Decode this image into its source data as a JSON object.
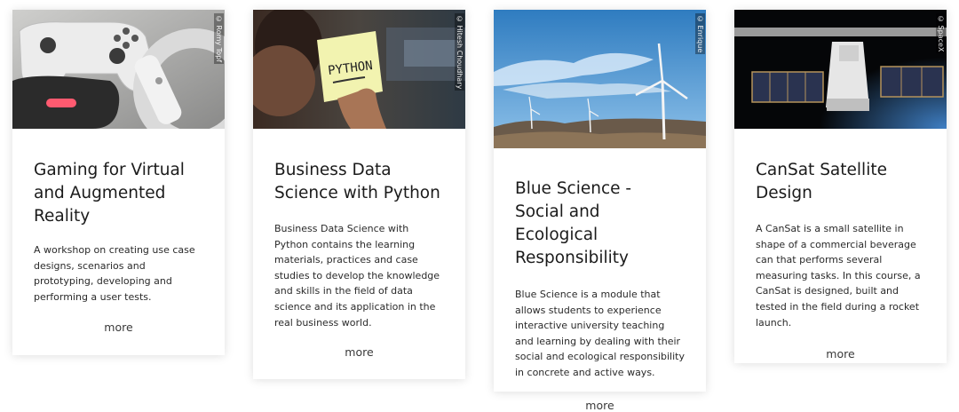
{
  "cards": [
    {
      "title": "Gaming for Virtual and Augmented Reality",
      "description": "A workshop on creating use case designs, scenarios and prototyping, developing and performing a user tests.",
      "more_label": "more",
      "image_credit": "© Romy Topf",
      "image_subject": "game-controllers-image"
    },
    {
      "title": "Business Data Science with Python",
      "description": "Business Data Science with Python contains the learning materials, practices and case studies to develop the knowledge and skills in the field of data science and its application in the real business world.",
      "more_label": "more",
      "image_credit": "© Hitesh Choudhary",
      "image_subject": "python-sticky-note-image",
      "image_text": "PYTHON"
    },
    {
      "title": "Blue Science - Social and Ecological Responsibility",
      "description": "Blue Science is a module that allows students to experience interactive university teaching and learning by dealing with their social and ecological responsibility in concrete and active ways.",
      "more_label": "more",
      "image_credit": "© Enrique",
      "image_subject": "wind-turbines-image"
    },
    {
      "title": "CanSat Satellite Design",
      "description": "A CanSat is a small satellite in shape of a commercial beverage can that performs several measuring tasks. In this course, a CanSat is designed, built and tested in the field during a rocket launch.",
      "more_label": "more",
      "image_credit": "© SpaceX",
      "image_subject": "satellite-image"
    }
  ]
}
